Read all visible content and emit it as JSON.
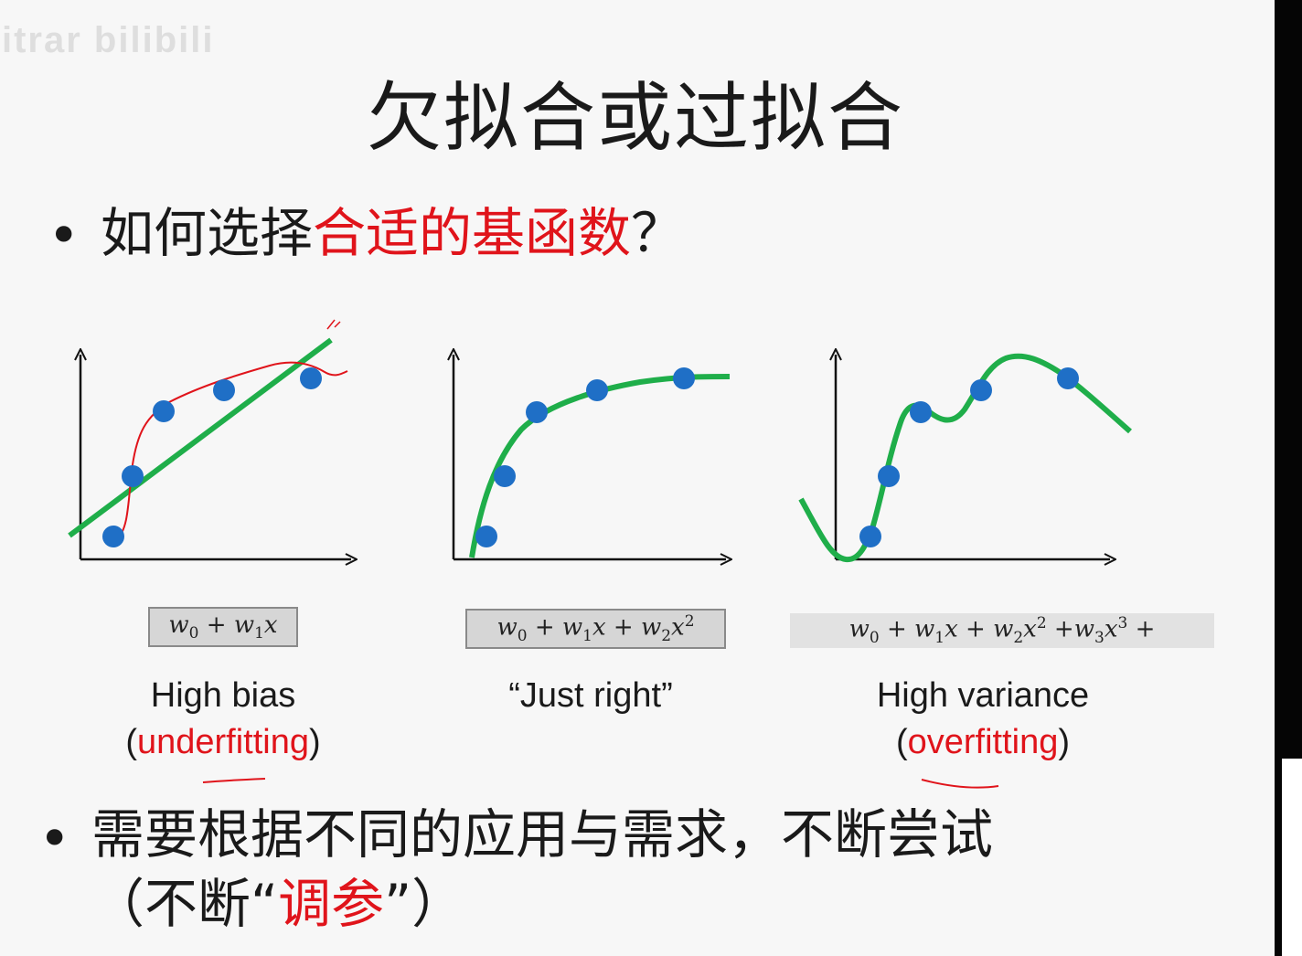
{
  "watermark": "itrar bilibili",
  "title": "欠拟合或过拟合",
  "bullet1": {
    "prefix": "如何选择",
    "highlight": "合适的基函数",
    "suffix": "？"
  },
  "panels": [
    {
      "formula": [
        "w",
        "0",
        " + w",
        "1",
        "x"
      ],
      "caption_line1": "High bias",
      "caption_open": "(",
      "caption_red": "underfitting",
      "caption_close": ")"
    },
    {
      "caption_line1": "“Just right”"
    },
    {
      "caption_line1": "High variance",
      "caption_open": "(",
      "caption_red": "overfitting",
      "caption_close": ")"
    }
  ],
  "bullet2": {
    "line1": "需要根据不同的应用与需求，不断尝试",
    "line2_prefix": "（不断“",
    "line2_highlight": "调参",
    "line2_suffix": "”）"
  },
  "colors": {
    "fit_curve": "#1fae4a",
    "data_point": "#1f6fc6",
    "annotation": "#e0141b",
    "text": "#1a1a1a"
  }
}
